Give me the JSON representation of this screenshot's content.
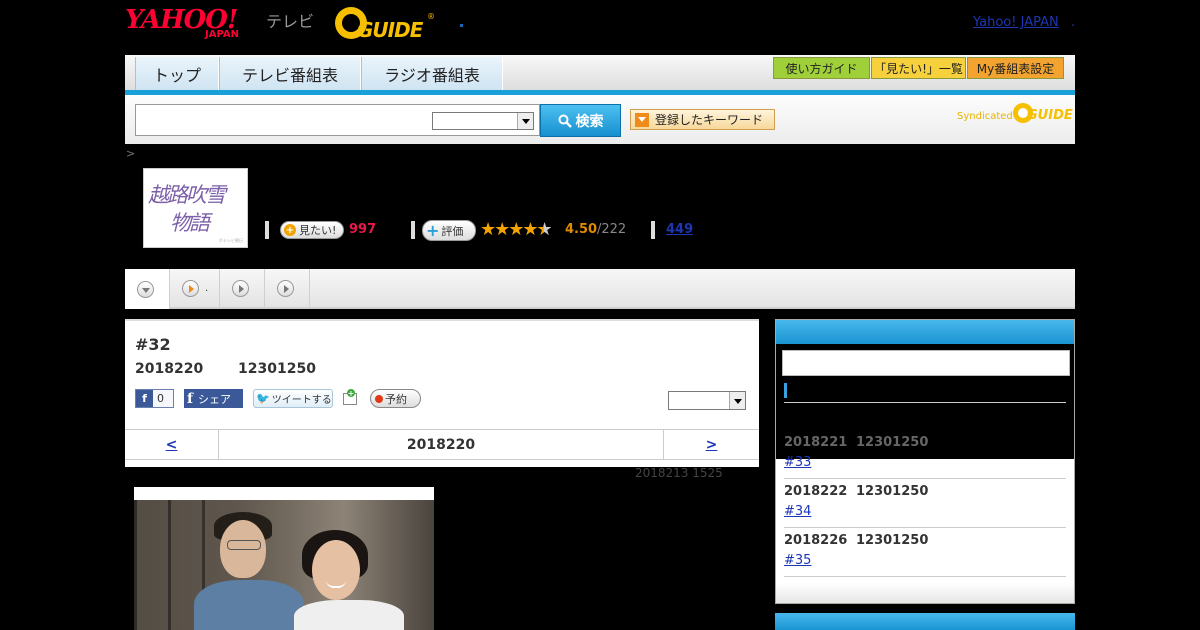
{
  "header": {
    "yahoo_logo": "YAHOO!",
    "yahoo_japan": "JAPAN",
    "tv_label": "テレビ",
    "gguide_logo": "GUIDE",
    "gguide_reg": "®",
    "yahoo_japan_link": "Yahoo! JAPAN",
    "yahoo_japan_link_suffix": ".",
    "nav_tabs": [
      "トップ",
      "テレビ番組表",
      "ラジオ番組表"
    ],
    "nav_buttons": [
      "使い方ガイド",
      "「見たい!」一覧",
      "My番組表設定"
    ],
    "nav_button_colors": [
      "#9fd03a",
      "#f6d13c",
      "#f3a430"
    ]
  },
  "search": {
    "input_value": "",
    "select_value": "",
    "button_label": "検索",
    "keyword_button_label": "登録したキーワード",
    "syndicated_label": "Syndicated",
    "syndicated_logo": "GUIDE"
  },
  "breadcrumb": ">",
  "program": {
    "thumb_title_line1": "越路吹雪",
    "thumb_title_line2": "物語",
    "thumb_credit": "©テレビ朝日",
    "mitai_label": "見たい!",
    "mitai_count": "997",
    "rating_label": "評価",
    "rating_value": "4.50",
    "rating_count": "/222",
    "rating_stars": 4.5,
    "review_count": "449"
  },
  "program_tabs": [
    {
      "icon": "chevron-down-icon",
      "label": ""
    },
    {
      "icon": "play-icon",
      "label": "."
    },
    {
      "icon": "play-icon",
      "label": ""
    },
    {
      "icon": "play-icon",
      "label": ""
    }
  ],
  "episode": {
    "number": "#32",
    "date": "2018220",
    "time": "12301250",
    "like_count": "0",
    "share_label": "シェア",
    "tweet_label": "ツイートする",
    "reserve_label": "予約",
    "select_value": "",
    "prev": "<",
    "current_date": "2018220",
    "next": ">"
  },
  "updated": "2018213  1525",
  "sidebar": {
    "items": [
      {
        "date": "2018221",
        "time": "12301250",
        "episode": "#33"
      },
      {
        "date": "2018222",
        "time": "12301250",
        "episode": "#34"
      },
      {
        "date": "2018226",
        "time": "12301250",
        "episode": "#35"
      }
    ]
  },
  "colors": {
    "accent_blue": "#19a0d8",
    "link": "#1c36b6",
    "mitai_pink": "#e8194a",
    "rating_orange": "#e08a00",
    "yahoo_red": "#ff0033",
    "gguide_yellow": "#f6bf00"
  }
}
